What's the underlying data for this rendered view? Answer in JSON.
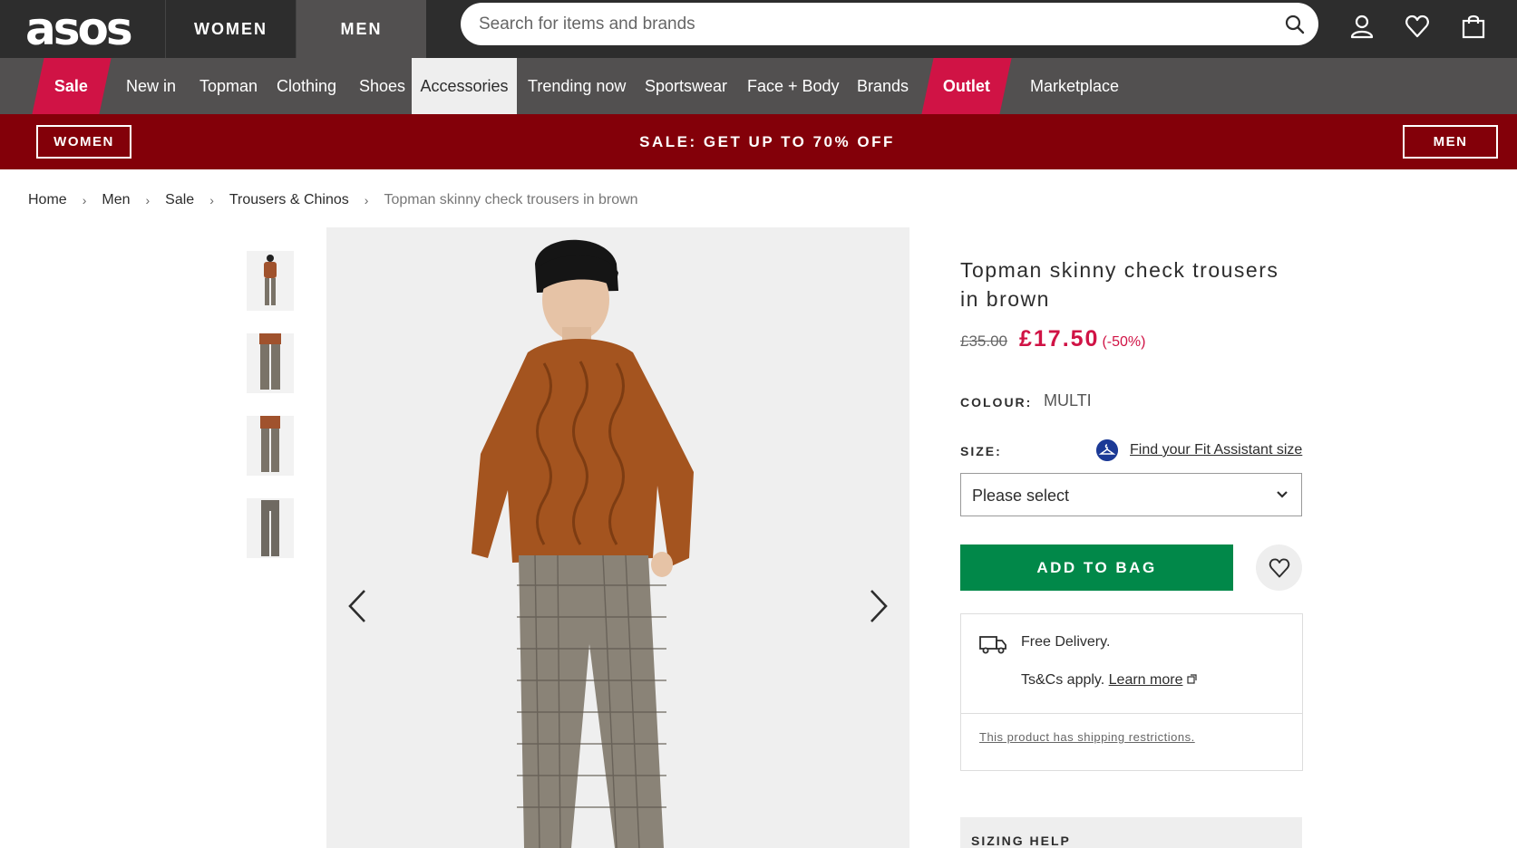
{
  "header": {
    "logo": "asos",
    "tabs": [
      {
        "label": "WOMEN"
      },
      {
        "label": "MEN"
      }
    ],
    "search_placeholder": "Search for items and brands",
    "icons": [
      "search-icon",
      "account-icon",
      "heart-icon",
      "bag-icon"
    ]
  },
  "nav": {
    "items": [
      {
        "label": "Sale"
      },
      {
        "label": "New in"
      },
      {
        "label": "Topman"
      },
      {
        "label": "Clothing"
      },
      {
        "label": "Shoes"
      },
      {
        "label": "Accessories"
      },
      {
        "label": "Trending now"
      },
      {
        "label": "Sportswear"
      },
      {
        "label": "Face + Body"
      },
      {
        "label": "Brands"
      },
      {
        "label": "Outlet"
      },
      {
        "label": "Marketplace"
      }
    ],
    "active": "Accessories"
  },
  "promo": {
    "women_button": "WOMEN",
    "text": "SALE: GET UP TO 70% OFF",
    "men_button": "MEN"
  },
  "breadcrumb": {
    "items": [
      "Home",
      "Men",
      "Sale",
      "Trousers & Chinos",
      "Topman skinny check trousers in brown"
    ],
    "separator": "›"
  },
  "product": {
    "title": "Topman skinny check trousers in brown",
    "price_old": "£35.00",
    "price_now": "£17.50",
    "discount": "(-50%)",
    "colour_label": "COLOUR:",
    "colour_value": "MULTI",
    "size_label": "SIZE:",
    "fit_link": "Find your Fit Assistant size",
    "size_placeholder": "Please select",
    "add_to_bag": "ADD TO BAG",
    "delivery": {
      "free": "Free Delivery.",
      "tscs": "Ts&Cs apply.",
      "learn_more": "Learn more",
      "shipping": "This product has shipping restrictions."
    },
    "sizing_help": "SIZING HELP"
  },
  "colors": {
    "header_bg": "#2d2d2d",
    "nav_bg": "#525050",
    "accent": "#d01345",
    "promo_bg": "#830009",
    "add_to_bag": "#018849"
  }
}
